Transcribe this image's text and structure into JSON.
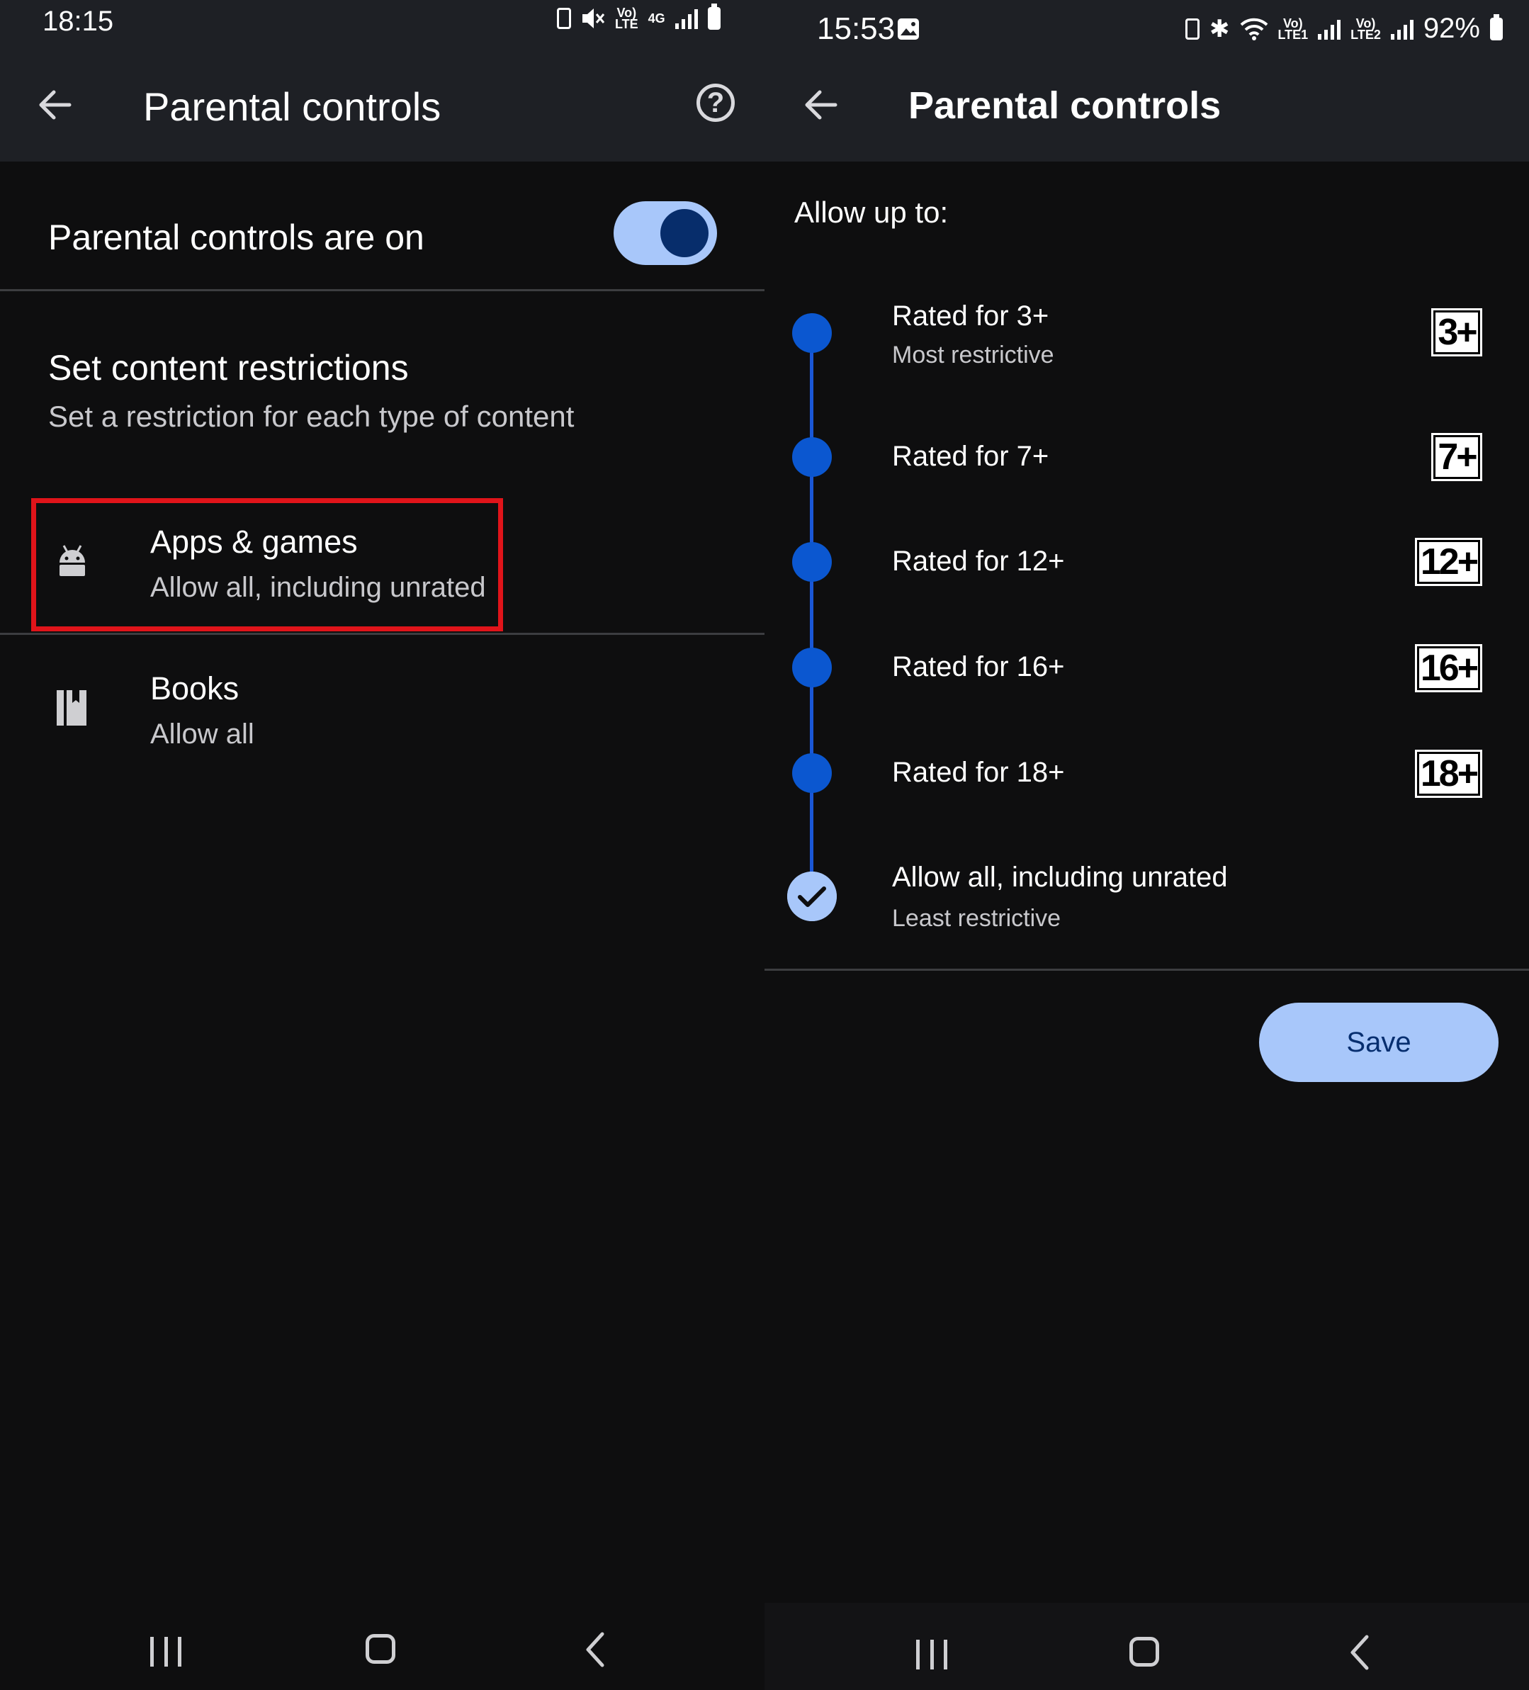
{
  "left": {
    "status": {
      "time": "18:15",
      "net_label": "4G"
    },
    "appbar": {
      "title": "Parental controls"
    },
    "toggle": {
      "label": "Parental controls are on",
      "state": "on"
    },
    "section": {
      "title": "Set content restrictions",
      "subtitle": "Set a restriction for each type of content"
    },
    "items": [
      {
        "title": "Apps & games",
        "subtitle": "Allow all, including unrated",
        "icon": "android-icon",
        "highlighted": true
      },
      {
        "title": "Books",
        "subtitle": "Allow all",
        "icon": "book-icon",
        "highlighted": false
      }
    ]
  },
  "right": {
    "status": {
      "time": "15:53",
      "battery": "92%"
    },
    "appbar": {
      "title": "Parental controls"
    },
    "allow_label": "Allow up to:",
    "ratings": [
      {
        "title": "Rated for 3+",
        "subtitle": "Most restrictive",
        "badge": "3+"
      },
      {
        "title": "Rated for 7+",
        "subtitle": "",
        "badge": "7+"
      },
      {
        "title": "Rated for 12+",
        "subtitle": "",
        "badge": "12+"
      },
      {
        "title": "Rated for 16+",
        "subtitle": "",
        "badge": "16+"
      },
      {
        "title": "Rated for 18+",
        "subtitle": "",
        "badge": "18+"
      },
      {
        "title": "Allow all, including unrated",
        "subtitle": "Least restrictive",
        "badge": "",
        "selected": true
      }
    ],
    "save_label": "Save"
  },
  "colors": {
    "accent_light": "#a8c7fa",
    "accent_dark": "#0b57d0",
    "highlight_box": "#e0141a",
    "appbar_bg": "#1e2025",
    "page_bg": "#0e0e0f"
  }
}
